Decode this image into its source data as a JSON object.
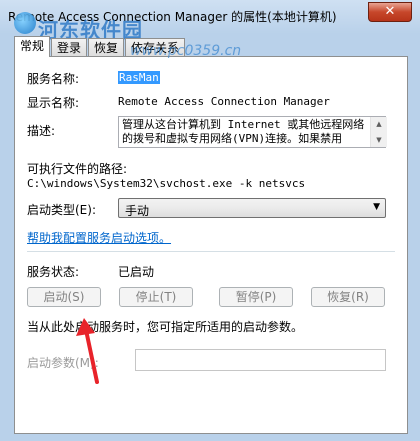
{
  "window": {
    "title": "Remote Access Connection Manager 的属性(本地计算机)",
    "close_glyph": "✕"
  },
  "watermark": {
    "main": "河东软件园",
    "url": "www.pc0359.cn"
  },
  "tabs": [
    {
      "label": "常规",
      "active": true
    },
    {
      "label": "登录",
      "active": false
    },
    {
      "label": "恢复",
      "active": false
    },
    {
      "label": "依存关系",
      "active": false
    }
  ],
  "general": {
    "service_name_label": "服务名称:",
    "service_name_value": "RasMan",
    "display_name_label": "显示名称:",
    "display_name_value": "Remote Access Connection Manager",
    "description_label": "描述:",
    "description_value": "管理从这台计算机到 Internet 或其他远程网络的拨号和虚拟专用网络(VPN)连接。如果禁用",
    "exe_path_label": "可执行文件的路径:",
    "exe_path_value": "C:\\windows\\System32\\svchost.exe -k netsvcs",
    "startup_type_label": "启动类型(E):",
    "startup_type_value": "手动",
    "help_link": "帮助我配置服务启动选项。",
    "service_status_label": "服务状态:",
    "service_status_value": "已启动",
    "buttons": {
      "start": "启动(S)",
      "stop": "停止(T)",
      "pause": "暂停(P)",
      "resume": "恢复(R)"
    },
    "hint_text": "当从此处启动服务时，您可指定所适用的启动参数。",
    "start_params_label": "启动参数(M):"
  },
  "colors": {
    "annotation_arrow": "#e8232a",
    "link": "#0066cc",
    "selection": "#3399ff"
  }
}
